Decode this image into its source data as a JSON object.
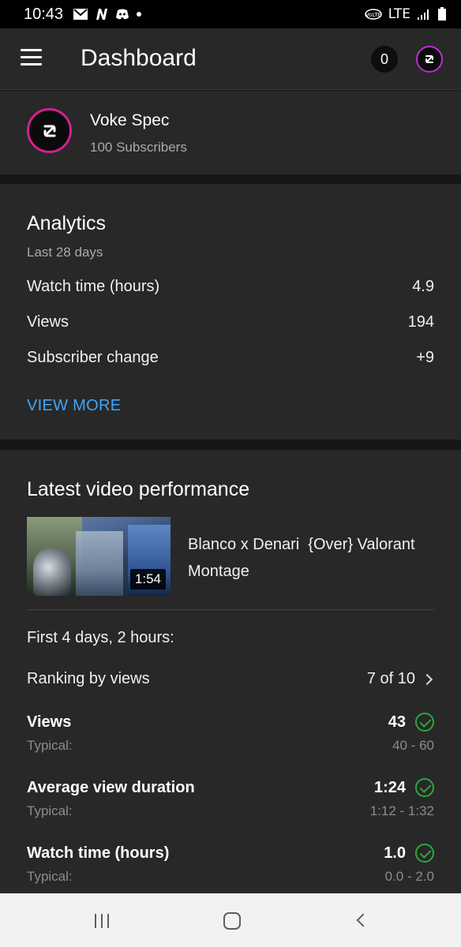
{
  "status_bar": {
    "time": "10:43",
    "network": "LTE",
    "left_icons": [
      "gmail-icon",
      "n-app-icon",
      "discord-icon",
      "dot-icon"
    ],
    "right_icons": [
      "volte-icon",
      "signal-icon",
      "battery-icon"
    ]
  },
  "app_bar": {
    "title": "Dashboard",
    "notification_count": "0"
  },
  "channel": {
    "name": "Voke Spec",
    "subscribers": "100 Subscribers"
  },
  "analytics": {
    "title": "Analytics",
    "period": "Last 28 days",
    "metrics": [
      {
        "label": "Watch time (hours)",
        "value": "4.9"
      },
      {
        "label": "Views",
        "value": "194"
      },
      {
        "label": "Subscriber change",
        "value": "+9"
      }
    ],
    "view_more": "VIEW MORE"
  },
  "latest_video": {
    "title": "Latest video performance",
    "video_title": "Blanco x Denari  {Over} Valorant Montage",
    "duration": "1:54",
    "period": "First 4 days, 2 hours:",
    "ranking_label": "Ranking by views",
    "ranking_value": "7 of 10",
    "metrics": [
      {
        "label": "Views",
        "value": "43",
        "typical_label": "Typical:",
        "typical_range": "40 - 60"
      },
      {
        "label": "Average view duration",
        "value": "1:24",
        "typical_label": "Typical:",
        "typical_range": "1:12 - 1:32"
      },
      {
        "label": "Watch time (hours)",
        "value": "1.0",
        "typical_label": "Typical:",
        "typical_range": "0.0 - 2.0"
      }
    ]
  },
  "colors": {
    "accent_blue": "#3ea6ff",
    "check_green": "#2ba640",
    "avatar_ring": "#c22bd9",
    "background": "#282828"
  }
}
